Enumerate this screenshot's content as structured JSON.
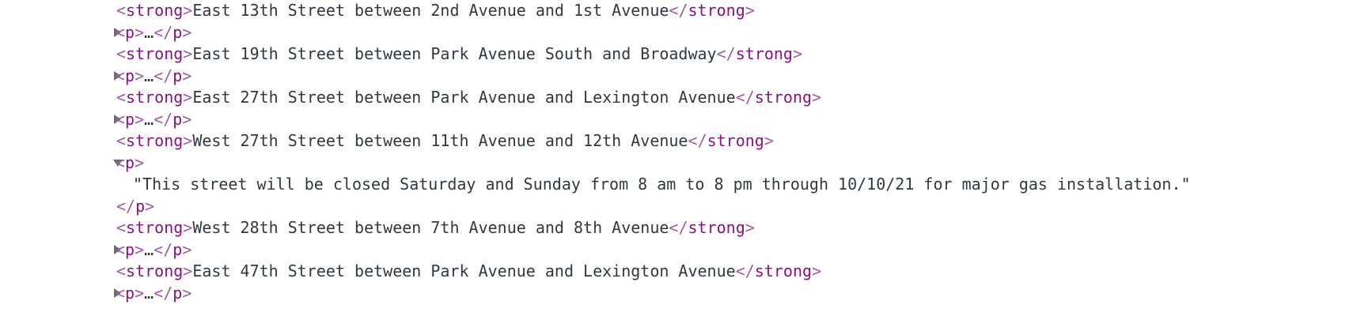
{
  "elements_panel": {
    "rows": [
      {
        "kind": "strong",
        "text": "East 13th Street between 2nd Avenue and 1st Avenue"
      },
      {
        "kind": "p-collapsed"
      },
      {
        "kind": "strong",
        "text": "East 19th Street between Park Avenue South and Broadway"
      },
      {
        "kind": "p-collapsed"
      },
      {
        "kind": "strong",
        "text": "East 27th Street between Park Avenue and Lexington Avenue"
      },
      {
        "kind": "p-collapsed"
      },
      {
        "kind": "strong",
        "text": "West 27th Street between 11th Avenue and 12th Avenue"
      },
      {
        "kind": "p-open"
      },
      {
        "kind": "text-node",
        "text": "\"This street will be closed Saturday and Sunday from 8 am to 8 pm through 10/10/21 for major gas installation.\""
      },
      {
        "kind": "p-close"
      },
      {
        "kind": "strong",
        "text": "West 28th Street between 7th Avenue and 8th Avenue"
      },
      {
        "kind": "p-collapsed"
      },
      {
        "kind": "strong",
        "text": "East 47th Street between Park Avenue and Lexington Avenue"
      },
      {
        "kind": "p-collapsed"
      }
    ],
    "tags": {
      "strong": "strong",
      "p": "p",
      "collapsed_ellipsis": "…"
    },
    "icons": {
      "collapsed": "triangle-right-icon",
      "expanded": "triangle-down-icon"
    },
    "colors": {
      "tag": "#881280",
      "bracket": "#a05da0",
      "text": "#303942",
      "toggle": "#6e6e6e"
    }
  }
}
